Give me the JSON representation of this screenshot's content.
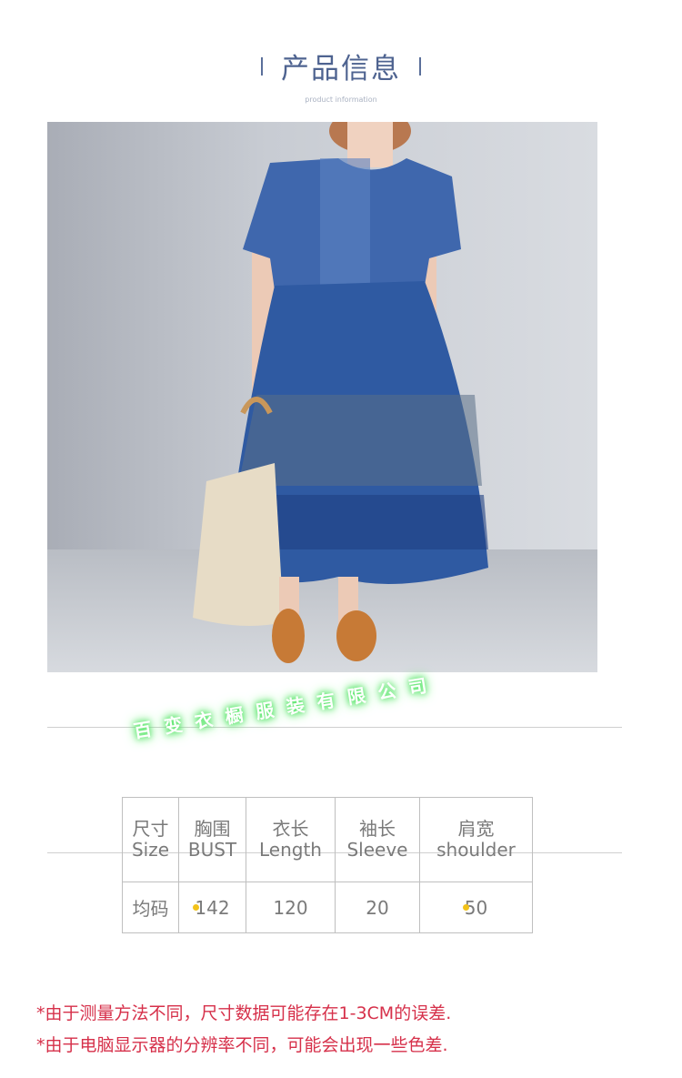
{
  "header": {
    "title": "产品信息",
    "subtitle": "product information"
  },
  "image": {
    "description_icon": "product-photo-blue-plaid-dress"
  },
  "watermark": "百变衣橱服装有限公司",
  "size_table": {
    "headers": [
      {
        "cn": "尺寸",
        "en": "Size"
      },
      {
        "cn": "胸围",
        "en": "BUST"
      },
      {
        "cn": "衣长",
        "en": "Length"
      },
      {
        "cn": "袖长",
        "en": "Sleeve"
      },
      {
        "cn": "肩宽",
        "en": "shoulder"
      }
    ],
    "rows": [
      [
        "均码",
        "142",
        "120",
        "20",
        "50"
      ]
    ]
  },
  "notes": [
    "*由于测量方法不同，尺寸数据可能存在1-3CM的误差.",
    "*由于电脑显示器的分辨率不同，可能会出现一些色差."
  ],
  "colors": {
    "title": "#4e6390",
    "note": "#d6304a",
    "watermark_glow": "#59e56a"
  }
}
